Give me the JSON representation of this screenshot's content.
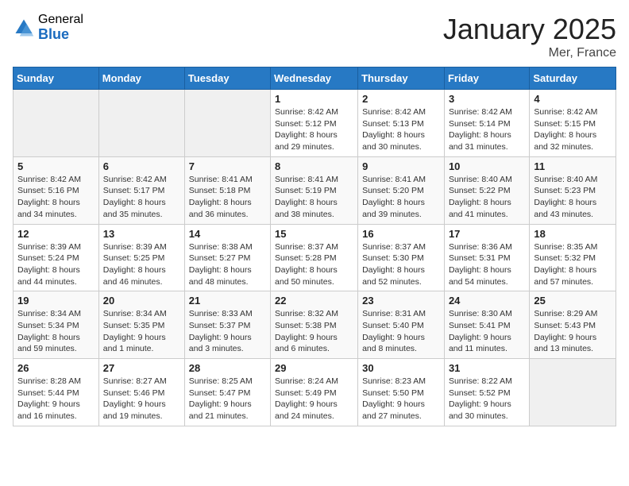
{
  "logo": {
    "general": "General",
    "blue": "Blue"
  },
  "header": {
    "month": "January 2025",
    "location": "Mer, France"
  },
  "weekdays": [
    "Sunday",
    "Monday",
    "Tuesday",
    "Wednesday",
    "Thursday",
    "Friday",
    "Saturday"
  ],
  "weeks": [
    [
      {
        "day": "",
        "sunrise": "",
        "sunset": "",
        "daylight": ""
      },
      {
        "day": "",
        "sunrise": "",
        "sunset": "",
        "daylight": ""
      },
      {
        "day": "",
        "sunrise": "",
        "sunset": "",
        "daylight": ""
      },
      {
        "day": "1",
        "sunrise": "Sunrise: 8:42 AM",
        "sunset": "Sunset: 5:12 PM",
        "daylight": "Daylight: 8 hours and 29 minutes."
      },
      {
        "day": "2",
        "sunrise": "Sunrise: 8:42 AM",
        "sunset": "Sunset: 5:13 PM",
        "daylight": "Daylight: 8 hours and 30 minutes."
      },
      {
        "day": "3",
        "sunrise": "Sunrise: 8:42 AM",
        "sunset": "Sunset: 5:14 PM",
        "daylight": "Daylight: 8 hours and 31 minutes."
      },
      {
        "day": "4",
        "sunrise": "Sunrise: 8:42 AM",
        "sunset": "Sunset: 5:15 PM",
        "daylight": "Daylight: 8 hours and 32 minutes."
      }
    ],
    [
      {
        "day": "5",
        "sunrise": "Sunrise: 8:42 AM",
        "sunset": "Sunset: 5:16 PM",
        "daylight": "Daylight: 8 hours and 34 minutes."
      },
      {
        "day": "6",
        "sunrise": "Sunrise: 8:42 AM",
        "sunset": "Sunset: 5:17 PM",
        "daylight": "Daylight: 8 hours and 35 minutes."
      },
      {
        "day": "7",
        "sunrise": "Sunrise: 8:41 AM",
        "sunset": "Sunset: 5:18 PM",
        "daylight": "Daylight: 8 hours and 36 minutes."
      },
      {
        "day": "8",
        "sunrise": "Sunrise: 8:41 AM",
        "sunset": "Sunset: 5:19 PM",
        "daylight": "Daylight: 8 hours and 38 minutes."
      },
      {
        "day": "9",
        "sunrise": "Sunrise: 8:41 AM",
        "sunset": "Sunset: 5:20 PM",
        "daylight": "Daylight: 8 hours and 39 minutes."
      },
      {
        "day": "10",
        "sunrise": "Sunrise: 8:40 AM",
        "sunset": "Sunset: 5:22 PM",
        "daylight": "Daylight: 8 hours and 41 minutes."
      },
      {
        "day": "11",
        "sunrise": "Sunrise: 8:40 AM",
        "sunset": "Sunset: 5:23 PM",
        "daylight": "Daylight: 8 hours and 43 minutes."
      }
    ],
    [
      {
        "day": "12",
        "sunrise": "Sunrise: 8:39 AM",
        "sunset": "Sunset: 5:24 PM",
        "daylight": "Daylight: 8 hours and 44 minutes."
      },
      {
        "day": "13",
        "sunrise": "Sunrise: 8:39 AM",
        "sunset": "Sunset: 5:25 PM",
        "daylight": "Daylight: 8 hours and 46 minutes."
      },
      {
        "day": "14",
        "sunrise": "Sunrise: 8:38 AM",
        "sunset": "Sunset: 5:27 PM",
        "daylight": "Daylight: 8 hours and 48 minutes."
      },
      {
        "day": "15",
        "sunrise": "Sunrise: 8:37 AM",
        "sunset": "Sunset: 5:28 PM",
        "daylight": "Daylight: 8 hours and 50 minutes."
      },
      {
        "day": "16",
        "sunrise": "Sunrise: 8:37 AM",
        "sunset": "Sunset: 5:30 PM",
        "daylight": "Daylight: 8 hours and 52 minutes."
      },
      {
        "day": "17",
        "sunrise": "Sunrise: 8:36 AM",
        "sunset": "Sunset: 5:31 PM",
        "daylight": "Daylight: 8 hours and 54 minutes."
      },
      {
        "day": "18",
        "sunrise": "Sunrise: 8:35 AM",
        "sunset": "Sunset: 5:32 PM",
        "daylight": "Daylight: 8 hours and 57 minutes."
      }
    ],
    [
      {
        "day": "19",
        "sunrise": "Sunrise: 8:34 AM",
        "sunset": "Sunset: 5:34 PM",
        "daylight": "Daylight: 8 hours and 59 minutes."
      },
      {
        "day": "20",
        "sunrise": "Sunrise: 8:34 AM",
        "sunset": "Sunset: 5:35 PM",
        "daylight": "Daylight: 9 hours and 1 minute."
      },
      {
        "day": "21",
        "sunrise": "Sunrise: 8:33 AM",
        "sunset": "Sunset: 5:37 PM",
        "daylight": "Daylight: 9 hours and 3 minutes."
      },
      {
        "day": "22",
        "sunrise": "Sunrise: 8:32 AM",
        "sunset": "Sunset: 5:38 PM",
        "daylight": "Daylight: 9 hours and 6 minutes."
      },
      {
        "day": "23",
        "sunrise": "Sunrise: 8:31 AM",
        "sunset": "Sunset: 5:40 PM",
        "daylight": "Daylight: 9 hours and 8 minutes."
      },
      {
        "day": "24",
        "sunrise": "Sunrise: 8:30 AM",
        "sunset": "Sunset: 5:41 PM",
        "daylight": "Daylight: 9 hours and 11 minutes."
      },
      {
        "day": "25",
        "sunrise": "Sunrise: 8:29 AM",
        "sunset": "Sunset: 5:43 PM",
        "daylight": "Daylight: 9 hours and 13 minutes."
      }
    ],
    [
      {
        "day": "26",
        "sunrise": "Sunrise: 8:28 AM",
        "sunset": "Sunset: 5:44 PM",
        "daylight": "Daylight: 9 hours and 16 minutes."
      },
      {
        "day": "27",
        "sunrise": "Sunrise: 8:27 AM",
        "sunset": "Sunset: 5:46 PM",
        "daylight": "Daylight: 9 hours and 19 minutes."
      },
      {
        "day": "28",
        "sunrise": "Sunrise: 8:25 AM",
        "sunset": "Sunset: 5:47 PM",
        "daylight": "Daylight: 9 hours and 21 minutes."
      },
      {
        "day": "29",
        "sunrise": "Sunrise: 8:24 AM",
        "sunset": "Sunset: 5:49 PM",
        "daylight": "Daylight: 9 hours and 24 minutes."
      },
      {
        "day": "30",
        "sunrise": "Sunrise: 8:23 AM",
        "sunset": "Sunset: 5:50 PM",
        "daylight": "Daylight: 9 hours and 27 minutes."
      },
      {
        "day": "31",
        "sunrise": "Sunrise: 8:22 AM",
        "sunset": "Sunset: 5:52 PM",
        "daylight": "Daylight: 9 hours and 30 minutes."
      },
      {
        "day": "",
        "sunrise": "",
        "sunset": "",
        "daylight": ""
      }
    ]
  ]
}
